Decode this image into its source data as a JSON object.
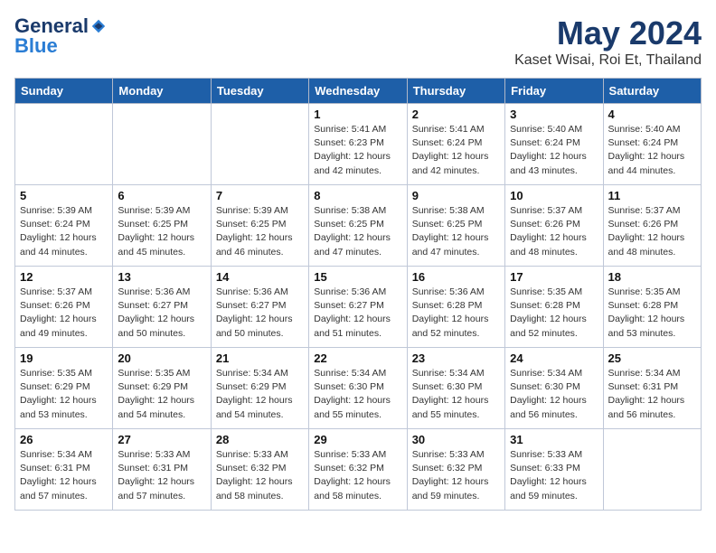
{
  "header": {
    "logo_general": "General",
    "logo_blue": "Blue",
    "month": "May 2024",
    "location": "Kaset Wisai, Roi Et, Thailand"
  },
  "weekdays": [
    "Sunday",
    "Monday",
    "Tuesday",
    "Wednesday",
    "Thursday",
    "Friday",
    "Saturday"
  ],
  "weeks": [
    [
      {
        "day": "",
        "info": ""
      },
      {
        "day": "",
        "info": ""
      },
      {
        "day": "",
        "info": ""
      },
      {
        "day": "1",
        "info": "Sunrise: 5:41 AM\nSunset: 6:23 PM\nDaylight: 12 hours\nand 42 minutes."
      },
      {
        "day": "2",
        "info": "Sunrise: 5:41 AM\nSunset: 6:24 PM\nDaylight: 12 hours\nand 42 minutes."
      },
      {
        "day": "3",
        "info": "Sunrise: 5:40 AM\nSunset: 6:24 PM\nDaylight: 12 hours\nand 43 minutes."
      },
      {
        "day": "4",
        "info": "Sunrise: 5:40 AM\nSunset: 6:24 PM\nDaylight: 12 hours\nand 44 minutes."
      }
    ],
    [
      {
        "day": "5",
        "info": "Sunrise: 5:39 AM\nSunset: 6:24 PM\nDaylight: 12 hours\nand 44 minutes."
      },
      {
        "day": "6",
        "info": "Sunrise: 5:39 AM\nSunset: 6:25 PM\nDaylight: 12 hours\nand 45 minutes."
      },
      {
        "day": "7",
        "info": "Sunrise: 5:39 AM\nSunset: 6:25 PM\nDaylight: 12 hours\nand 46 minutes."
      },
      {
        "day": "8",
        "info": "Sunrise: 5:38 AM\nSunset: 6:25 PM\nDaylight: 12 hours\nand 47 minutes."
      },
      {
        "day": "9",
        "info": "Sunrise: 5:38 AM\nSunset: 6:25 PM\nDaylight: 12 hours\nand 47 minutes."
      },
      {
        "day": "10",
        "info": "Sunrise: 5:37 AM\nSunset: 6:26 PM\nDaylight: 12 hours\nand 48 minutes."
      },
      {
        "day": "11",
        "info": "Sunrise: 5:37 AM\nSunset: 6:26 PM\nDaylight: 12 hours\nand 48 minutes."
      }
    ],
    [
      {
        "day": "12",
        "info": "Sunrise: 5:37 AM\nSunset: 6:26 PM\nDaylight: 12 hours\nand 49 minutes."
      },
      {
        "day": "13",
        "info": "Sunrise: 5:36 AM\nSunset: 6:27 PM\nDaylight: 12 hours\nand 50 minutes."
      },
      {
        "day": "14",
        "info": "Sunrise: 5:36 AM\nSunset: 6:27 PM\nDaylight: 12 hours\nand 50 minutes."
      },
      {
        "day": "15",
        "info": "Sunrise: 5:36 AM\nSunset: 6:27 PM\nDaylight: 12 hours\nand 51 minutes."
      },
      {
        "day": "16",
        "info": "Sunrise: 5:36 AM\nSunset: 6:28 PM\nDaylight: 12 hours\nand 52 minutes."
      },
      {
        "day": "17",
        "info": "Sunrise: 5:35 AM\nSunset: 6:28 PM\nDaylight: 12 hours\nand 52 minutes."
      },
      {
        "day": "18",
        "info": "Sunrise: 5:35 AM\nSunset: 6:28 PM\nDaylight: 12 hours\nand 53 minutes."
      }
    ],
    [
      {
        "day": "19",
        "info": "Sunrise: 5:35 AM\nSunset: 6:29 PM\nDaylight: 12 hours\nand 53 minutes."
      },
      {
        "day": "20",
        "info": "Sunrise: 5:35 AM\nSunset: 6:29 PM\nDaylight: 12 hours\nand 54 minutes."
      },
      {
        "day": "21",
        "info": "Sunrise: 5:34 AM\nSunset: 6:29 PM\nDaylight: 12 hours\nand 54 minutes."
      },
      {
        "day": "22",
        "info": "Sunrise: 5:34 AM\nSunset: 6:30 PM\nDaylight: 12 hours\nand 55 minutes."
      },
      {
        "day": "23",
        "info": "Sunrise: 5:34 AM\nSunset: 6:30 PM\nDaylight: 12 hours\nand 55 minutes."
      },
      {
        "day": "24",
        "info": "Sunrise: 5:34 AM\nSunset: 6:30 PM\nDaylight: 12 hours\nand 56 minutes."
      },
      {
        "day": "25",
        "info": "Sunrise: 5:34 AM\nSunset: 6:31 PM\nDaylight: 12 hours\nand 56 minutes."
      }
    ],
    [
      {
        "day": "26",
        "info": "Sunrise: 5:34 AM\nSunset: 6:31 PM\nDaylight: 12 hours\nand 57 minutes."
      },
      {
        "day": "27",
        "info": "Sunrise: 5:33 AM\nSunset: 6:31 PM\nDaylight: 12 hours\nand 57 minutes."
      },
      {
        "day": "28",
        "info": "Sunrise: 5:33 AM\nSunset: 6:32 PM\nDaylight: 12 hours\nand 58 minutes."
      },
      {
        "day": "29",
        "info": "Sunrise: 5:33 AM\nSunset: 6:32 PM\nDaylight: 12 hours\nand 58 minutes."
      },
      {
        "day": "30",
        "info": "Sunrise: 5:33 AM\nSunset: 6:32 PM\nDaylight: 12 hours\nand 59 minutes."
      },
      {
        "day": "31",
        "info": "Sunrise: 5:33 AM\nSunset: 6:33 PM\nDaylight: 12 hours\nand 59 minutes."
      },
      {
        "day": "",
        "info": ""
      }
    ]
  ]
}
